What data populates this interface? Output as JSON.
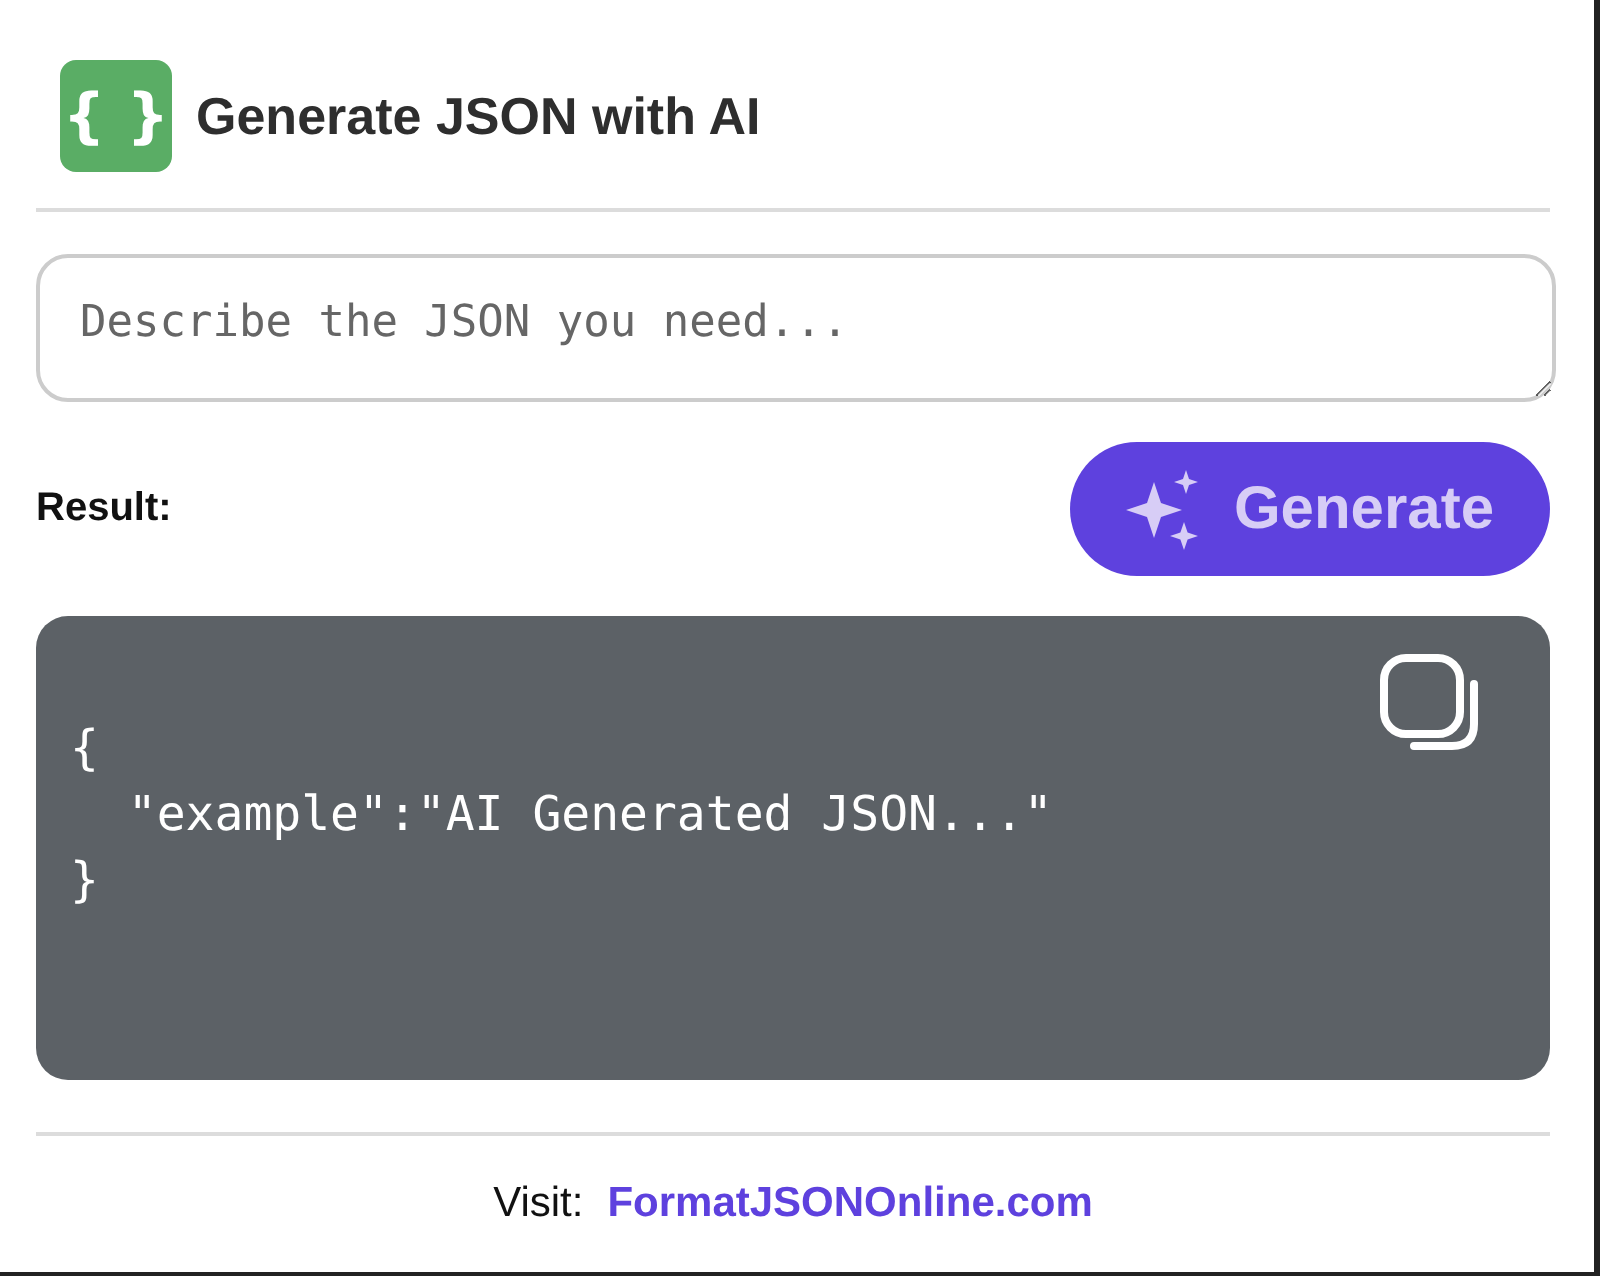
{
  "header": {
    "logo": "{ }",
    "title": "Generate JSON with AI"
  },
  "prompt": {
    "placeholder": "Describe the JSON you need..."
  },
  "result_label": "Result:",
  "generate_button": {
    "label": "Generate",
    "disabled": true
  },
  "result": {
    "lines": [
      "{",
      "  \"example\":\"AI Generated JSON...\"",
      "}"
    ]
  },
  "footer": {
    "text": "Visit:",
    "link": "FormatJSONOnline.com"
  }
}
